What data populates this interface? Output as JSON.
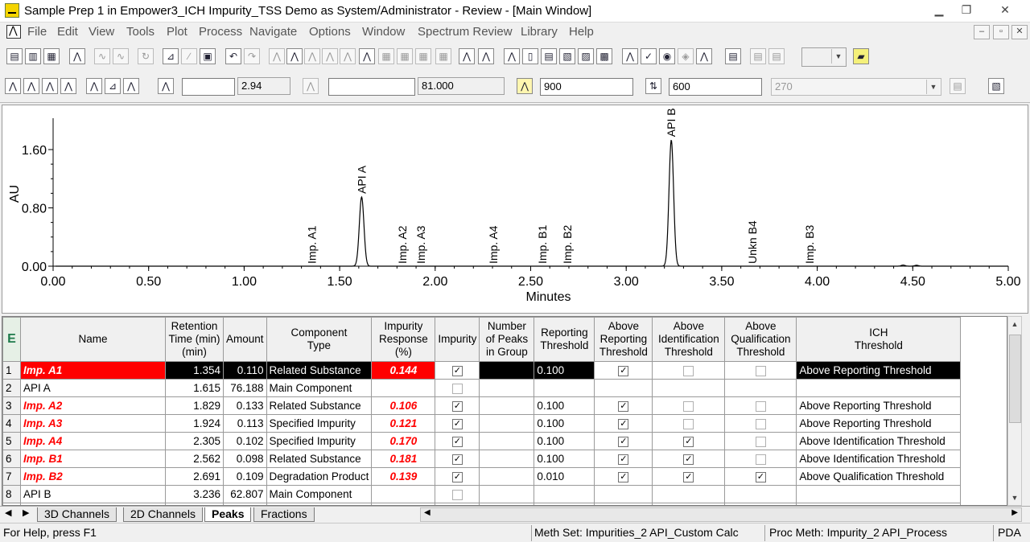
{
  "window": {
    "title": "Sample Prep 1 in Empower3_ICH Impurity_TSS Demo as System/Administrator - Review - [Main Window]",
    "controls": [
      "▁",
      "❐",
      "✕"
    ]
  },
  "menu": [
    "File",
    "Edit",
    "View",
    "Tools",
    "Plot",
    "Process",
    "Navigate",
    "Options",
    "Window",
    "Spectrum Review",
    "Library",
    "Help"
  ],
  "mdi_controls": [
    "–",
    "▫",
    "✕"
  ],
  "toolbar2": {
    "field_a": "",
    "field_b": "2.94",
    "field_c": "",
    "field_d": "81.000",
    "field_e": "900",
    "field_f": "600",
    "field_g": "270"
  },
  "chart_data": {
    "type": "line",
    "title": "",
    "xlabel": "Minutes",
    "ylabel": "AU",
    "xlim": [
      0.0,
      5.0
    ],
    "ylim": [
      -0.05,
      1.95
    ],
    "x_ticks": [
      "0.00",
      "0.50",
      "1.00",
      "1.50",
      "2.00",
      "2.50",
      "3.00",
      "3.50",
      "4.00",
      "4.50",
      "5.00"
    ],
    "y_ticks": [
      "0.00",
      "0.80",
      "1.60"
    ],
    "x_tick_values": [
      0,
      0.5,
      1,
      1.5,
      2,
      2.5,
      3,
      3.5,
      4,
      4.5,
      5
    ],
    "y_tick_values": [
      0,
      0.8,
      1.6
    ],
    "series": [
      {
        "peaks": [
          {
            "rt": 1.615,
            "height": 0.95
          },
          {
            "rt": 3.236,
            "height": 1.73
          },
          {
            "rt": 4.45,
            "height": 0.015
          },
          {
            "rt": 4.52,
            "height": 0.012
          }
        ]
      }
    ],
    "peak_labels": [
      {
        "label": "Imp. A1",
        "rt": 1.354
      },
      {
        "label": "API A",
        "rt": 1.615
      },
      {
        "label": "Imp. A2",
        "rt": 1.829
      },
      {
        "label": "Imp. A3",
        "rt": 1.924
      },
      {
        "label": "Imp. A4",
        "rt": 2.305
      },
      {
        "label": "Imp. B1",
        "rt": 2.562
      },
      {
        "label": "Imp. B2",
        "rt": 2.691
      },
      {
        "label": "API B",
        "rt": 3.236
      },
      {
        "label": "Unkn B4",
        "rt": 3.66
      },
      {
        "label": "Imp. B3",
        "rt": 3.96
      }
    ]
  },
  "table": {
    "headers": [
      "",
      "Name",
      "Retention Time (min) (min)",
      "Amount",
      "Component Type",
      "Impurity Response (%)",
      "Impurity",
      "Number of Peaks in Group",
      "Reporting Threshold",
      "Above Reporting Threshold",
      "Above Identification Threshold",
      "Above Qualification Threshold",
      "ICH Threshold"
    ],
    "header_lines": [
      [
        ""
      ],
      [
        "Name"
      ],
      [
        "Retention",
        "Time (min)",
        "(min)"
      ],
      [
        "Amount"
      ],
      [
        "Component",
        "Type"
      ],
      [
        "Impurity",
        "Response",
        "(%)"
      ],
      [
        "Impurity"
      ],
      [
        "Number",
        "of Peaks",
        "in Group"
      ],
      [
        "Reporting",
        "Threshold"
      ],
      [
        "Above",
        "Reporting",
        "Threshold"
      ],
      [
        "Above",
        "Identification",
        "Threshold"
      ],
      [
        "Above",
        "Qualification",
        "Threshold"
      ],
      [
        "ICH",
        "Threshold"
      ]
    ],
    "rows": [
      {
        "n": "1",
        "name": "Imp. A1",
        "rt": "1.354",
        "amount": "0.110",
        "type": "Related Substance",
        "resp": "0.144",
        "impurity": true,
        "npeaks": "",
        "rep": "0.100",
        "above_rep": true,
        "above_id": false,
        "above_q": false,
        "ich": "Above Reporting Threshold",
        "red": true,
        "selected": true
      },
      {
        "n": "2",
        "name": "API A",
        "rt": "1.615",
        "amount": "76.188",
        "type": "Main Component",
        "resp": "",
        "impurity": false,
        "npeaks": "",
        "rep": "",
        "above_rep": null,
        "above_id": null,
        "above_q": null,
        "ich": "",
        "red": false,
        "selected": false
      },
      {
        "n": "3",
        "name": "Imp. A2",
        "rt": "1.829",
        "amount": "0.133",
        "type": "Related Substance",
        "resp": "0.106",
        "impurity": true,
        "npeaks": "",
        "rep": "0.100",
        "above_rep": true,
        "above_id": false,
        "above_q": false,
        "ich": "Above Reporting Threshold",
        "red": true,
        "selected": false
      },
      {
        "n": "4",
        "name": "Imp. A3",
        "rt": "1.924",
        "amount": "0.113",
        "type": "Specified Impurity",
        "resp": "0.121",
        "impurity": true,
        "npeaks": "",
        "rep": "0.100",
        "above_rep": true,
        "above_id": false,
        "above_q": false,
        "ich": "Above Reporting Threshold",
        "red": true,
        "selected": false
      },
      {
        "n": "5",
        "name": "Imp. A4",
        "rt": "2.305",
        "amount": "0.102",
        "type": "Specified Impurity",
        "resp": "0.170",
        "impurity": true,
        "npeaks": "",
        "rep": "0.100",
        "above_rep": true,
        "above_id": true,
        "above_q": false,
        "ich": "Above Identification Threshold",
        "red": true,
        "selected": false
      },
      {
        "n": "6",
        "name": "Imp. B1",
        "rt": "2.562",
        "amount": "0.098",
        "type": "Related Substance",
        "resp": "0.181",
        "impurity": true,
        "npeaks": "",
        "rep": "0.100",
        "above_rep": true,
        "above_id": true,
        "above_q": false,
        "ich": "Above Identification Threshold",
        "red": true,
        "selected": false
      },
      {
        "n": "7",
        "name": "Imp. B2",
        "rt": "2.691",
        "amount": "0.109",
        "type": "Degradation Product",
        "resp": "0.139",
        "impurity": true,
        "npeaks": "",
        "rep": "0.010",
        "above_rep": true,
        "above_id": true,
        "above_q": true,
        "ich": "Above Qualification Threshold",
        "red": true,
        "selected": false
      },
      {
        "n": "8",
        "name": "API B",
        "rt": "3.236",
        "amount": "62.807",
        "type": "Main Component",
        "resp": "",
        "impurity": false,
        "npeaks": "",
        "rep": "",
        "above_rep": null,
        "above_id": null,
        "above_q": null,
        "ich": "",
        "red": false,
        "selected": false
      }
    ]
  },
  "tabs": [
    {
      "label": "3D Channels",
      "active": false
    },
    {
      "label": "2D Channels",
      "active": false
    },
    {
      "label": "Peaks",
      "active": true
    },
    {
      "label": "Fractions",
      "active": false
    }
  ],
  "status": {
    "help": "For Help, press F1",
    "meth_set": "Meth Set: Impurities_2 API_Custom Calc",
    "proc_meth": "Proc Meth: Impurity_2 API_Process",
    "detector": "PDA"
  },
  "colors": {
    "highlight_red": "#ff0000",
    "selection_black": "#000000",
    "chart_line": "#000000"
  }
}
